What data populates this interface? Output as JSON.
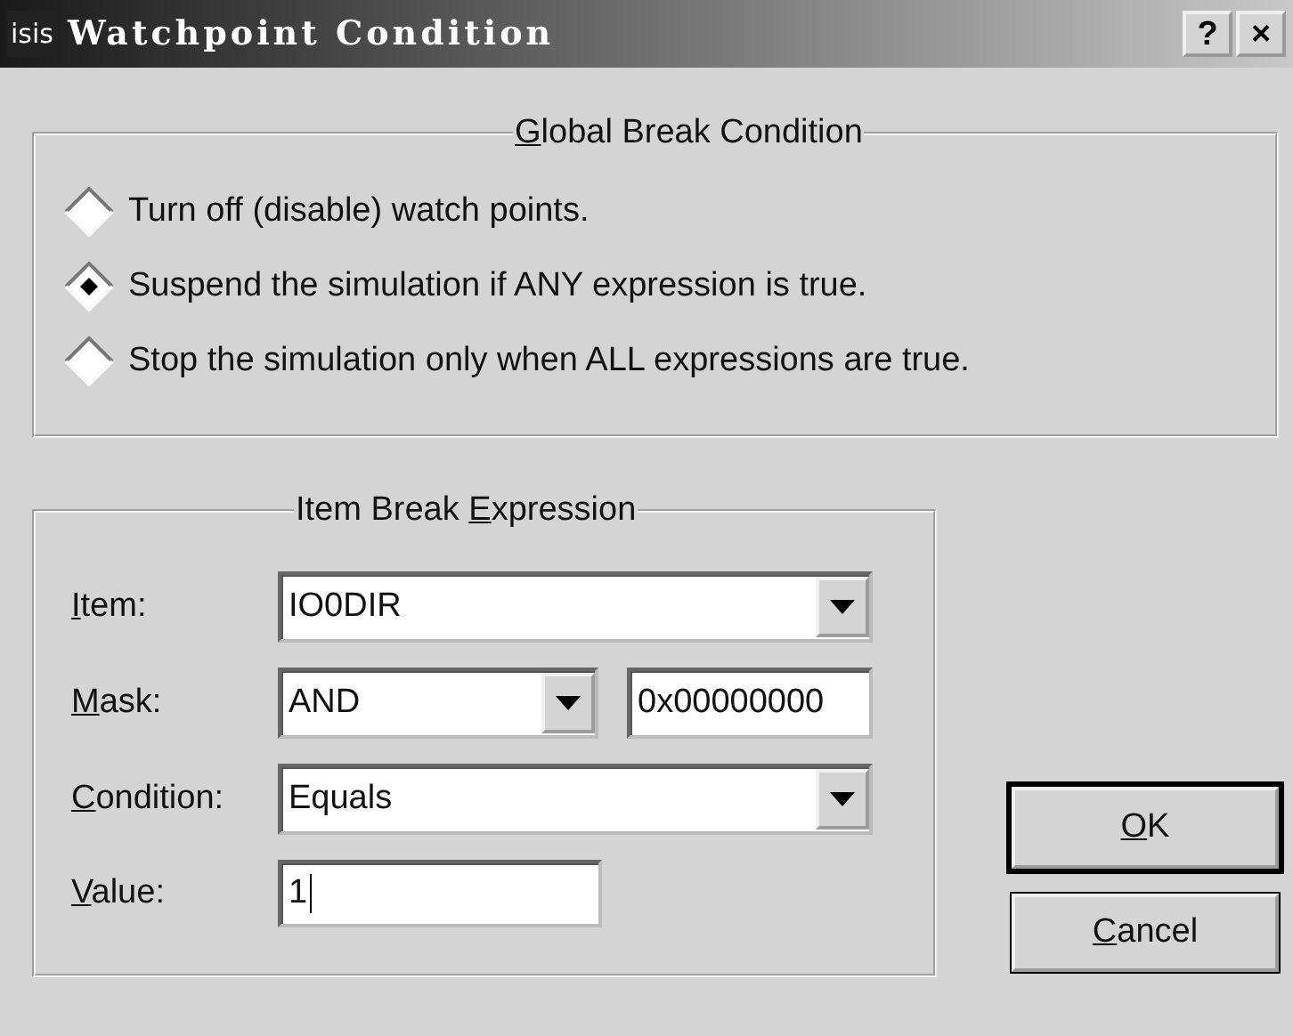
{
  "window": {
    "logo": "isis",
    "title": "Watchpoint Condition",
    "title_buttons": [
      "?",
      "×"
    ]
  },
  "global_break": {
    "title": [
      {
        "text": "G",
        "underlined": true
      },
      {
        "text": "lobal Break Condition",
        "underlined": false
      }
    ],
    "options": [
      {
        "label": "Turn off (disable) watch points.",
        "selected": false
      },
      {
        "label": "Suspend the simulation if ANY expression is true.",
        "selected": true
      },
      {
        "label": "Stop the simulation only when ALL expressions are true.",
        "selected": false
      }
    ]
  },
  "item_break": {
    "title": [
      {
        "text": "Item Break ",
        "underlined": false
      },
      {
        "text": "E",
        "underlined": true
      },
      {
        "text": "xpression",
        "underlined": false
      }
    ],
    "rows": [
      {
        "kind": "combo",
        "label": [
          {
            "text": "I",
            "underlined": true
          },
          {
            "text": "tem:",
            "underlined": false
          }
        ],
        "value": "IO0DIR"
      },
      {
        "kind": "combo_hex",
        "label": [
          {
            "text": "M",
            "underlined": true
          },
          {
            "text": "ask:",
            "underlined": false
          }
        ],
        "value": "AND",
        "extra": "0x00000000"
      },
      {
        "kind": "combo",
        "label": [
          {
            "text": "C",
            "underlined": true
          },
          {
            "text": "ondition:",
            "underlined": false
          }
        ],
        "value": "Equals"
      },
      {
        "kind": "text",
        "label": [
          {
            "text": "V",
            "underlined": true
          },
          {
            "text": "alue:",
            "underlined": false
          }
        ],
        "value": "1"
      }
    ]
  },
  "buttons": [
    {
      "label": [
        {
          "text": "O",
          "underlined": true
        },
        {
          "text": "K",
          "underlined": false
        }
      ],
      "default": true
    },
    {
      "label": [
        {
          "text": "C",
          "underlined": true
        },
        {
          "text": "ancel",
          "underlined": false
        }
      ],
      "default": false
    }
  ]
}
